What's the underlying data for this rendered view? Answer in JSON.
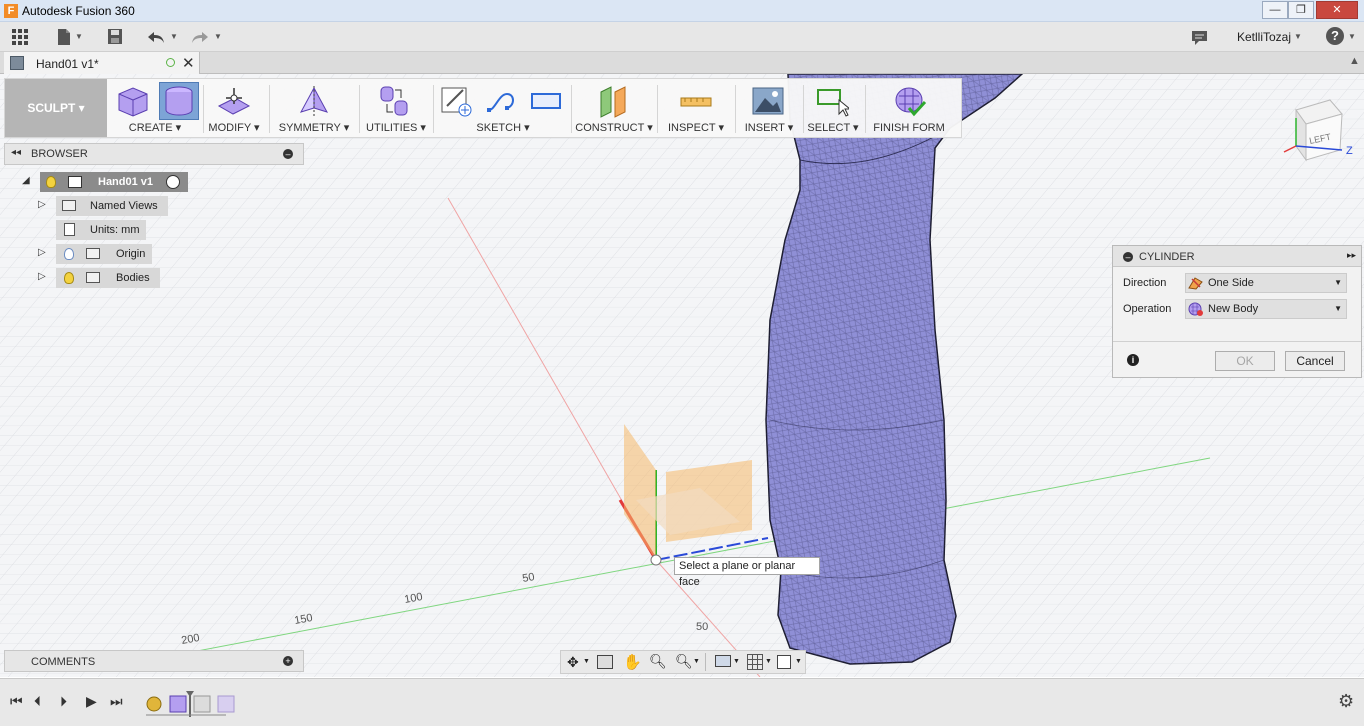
{
  "window": {
    "title": "Autodesk Fusion 360",
    "app_icon_letter": "F",
    "minimize": "—",
    "maximize": "❐",
    "close": "✕"
  },
  "quick_access": {
    "user": "KetlliTozaj",
    "help": "?"
  },
  "document_tab": {
    "name": "Hand01 v1*"
  },
  "ribbon": {
    "workspace": "SCULPT",
    "groups": {
      "create": "CREATE",
      "modify": "MODIFY",
      "symmetry": "SYMMETRY",
      "utilities": "UTILITIES",
      "sketch": "SKETCH",
      "construct": "CONSTRUCT",
      "inspect": "INSPECT",
      "insert": "INSERT",
      "select": "SELECT",
      "finish": "FINISH FORM"
    }
  },
  "browser": {
    "title": "BROWSER",
    "root": "Hand01 v1",
    "items": [
      {
        "label": "Named Views"
      },
      {
        "label": "Units: mm"
      },
      {
        "label": "Origin"
      },
      {
        "label": "Bodies"
      }
    ]
  },
  "dialog": {
    "title": "CYLINDER",
    "direction_label": "Direction",
    "direction_value": "One Side",
    "operation_label": "Operation",
    "operation_value": "New Body",
    "ok": "OK",
    "cancel": "Cancel"
  },
  "tooltip": "Select a plane or planar face",
  "axis_ticks": [
    "50",
    "100",
    "150",
    "200",
    "50"
  ],
  "viewcube_face": "LEFT",
  "comments": {
    "title": "COMMENTS"
  },
  "colors": {
    "mesh_fill": "#8f8fd6",
    "mesh_edge": "#3a3a6a",
    "x_axis": "#e23b3b",
    "y_axis": "#2db52d",
    "z_axis": "#2a4ad8",
    "plane": "#f5b86a",
    "close_button": "#c9483f"
  }
}
